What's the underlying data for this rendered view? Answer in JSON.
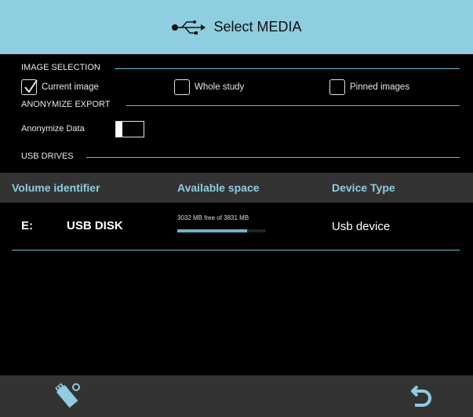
{
  "header": {
    "title": "Select MEDIA",
    "icon": "usb-icon",
    "background": "#8fcde0"
  },
  "image_selection": {
    "label": "IMAGE SELECTION",
    "options": [
      {
        "label": "Current image",
        "checked": true
      },
      {
        "label": "Whole study",
        "checked": false
      },
      {
        "label": "Pinned images",
        "checked": false
      }
    ]
  },
  "anonymize": {
    "label": "ANONYMIZE EXPORT",
    "toggle_label": "Anonymize Data",
    "enabled": false
  },
  "usb": {
    "label": "USB DRIVES",
    "columns": [
      "Volume identifier",
      "Available space",
      "Device Type"
    ],
    "rows": [
      {
        "drive": "E:",
        "volume": "USB DISK",
        "space_text": "3032 MB free of 3831 MB",
        "free_fraction": 0.79,
        "type": "Usb device"
      }
    ]
  },
  "footer": {
    "eject_icon": "usb-eject-icon",
    "back_icon": "back-arrow-icon"
  },
  "colors": {
    "accent": "#8fcde0",
    "line": "#6ab4cf",
    "bar": "#333333"
  }
}
